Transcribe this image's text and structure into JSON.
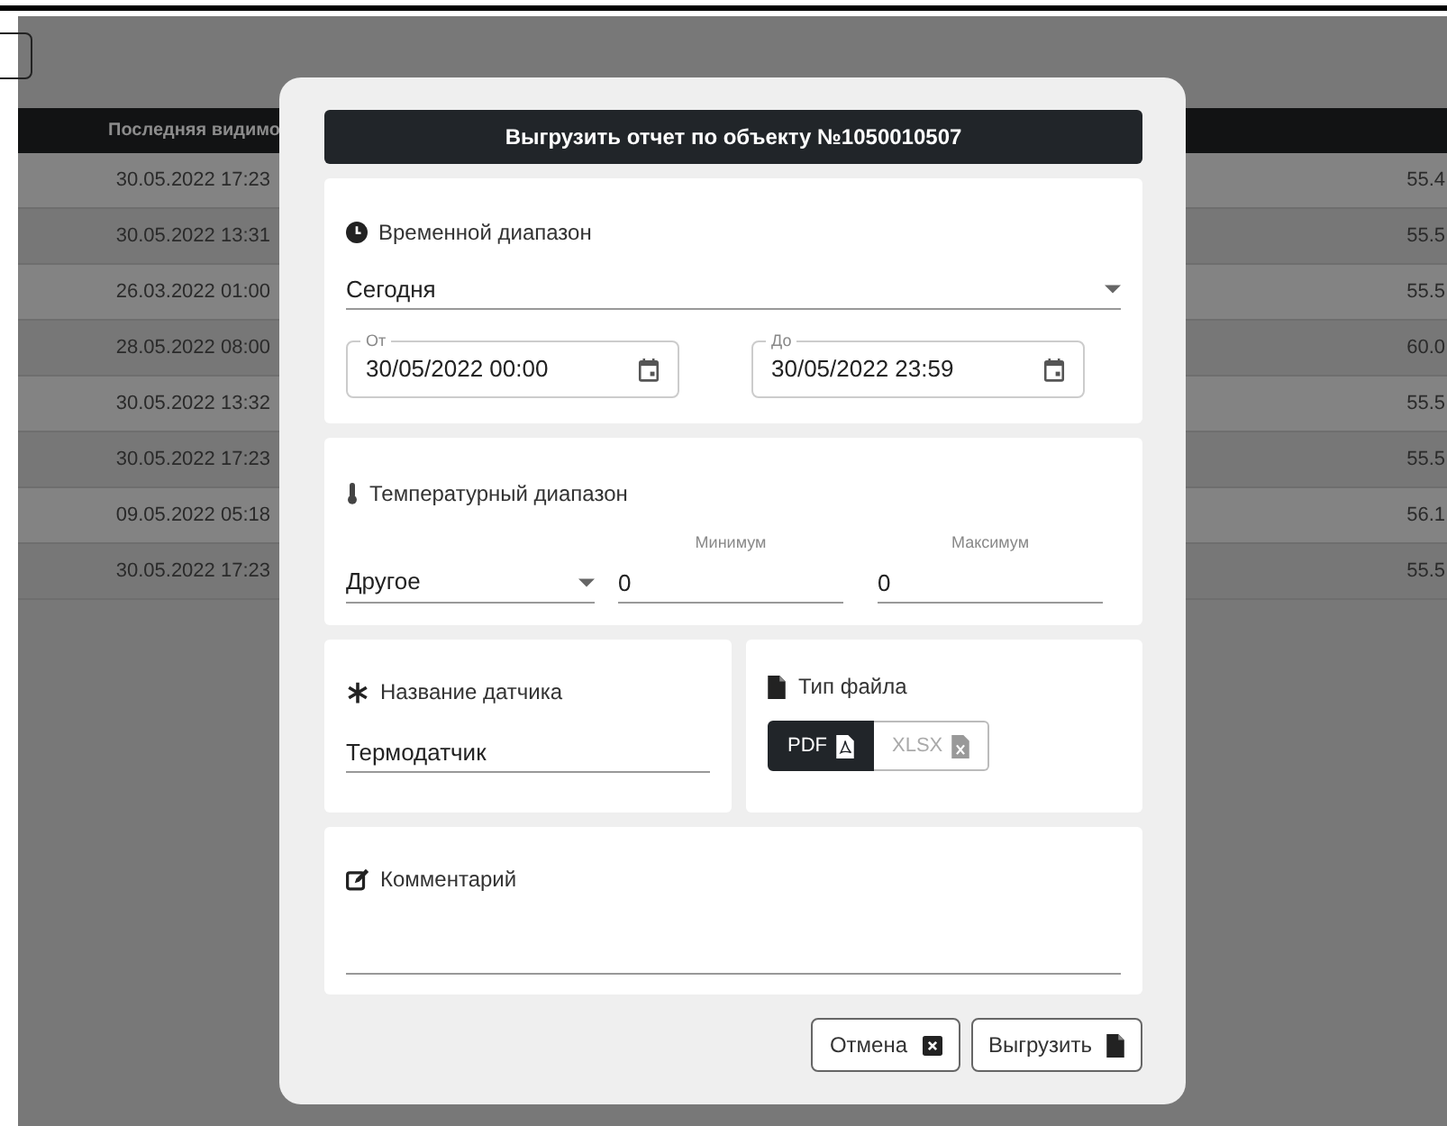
{
  "background_table": {
    "columns": [
      {
        "label": "Последняя видимо"
      }
    ],
    "rows": [
      {
        "last_seen": "30.05.2022 17:23",
        "column_2": "55.4"
      },
      {
        "last_seen": "30.05.2022 13:31",
        "column_2": "55.5"
      },
      {
        "last_seen": "26.03.2022 01:00",
        "column_2": "55.5"
      },
      {
        "last_seen": "28.05.2022 08:00",
        "column_2": "60.0"
      },
      {
        "last_seen": "30.05.2022 13:32",
        "column_2": "55.5"
      },
      {
        "last_seen": "30.05.2022 17:23",
        "column_2": "55.5"
      },
      {
        "last_seen": "09.05.2022 05:18",
        "column_2": "56.1"
      },
      {
        "last_seen": "30.05.2022 17:23",
        "column_2": "55.5"
      }
    ]
  },
  "dialog": {
    "title": "Выгрузить отчет по объекту №1050010507",
    "time_range": {
      "label": "Временной диапазон",
      "preset": "Сегодня",
      "from": {
        "label": "От",
        "value": "30/05/2022 00:00"
      },
      "to": {
        "label": "До",
        "value": "30/05/2022 23:59"
      }
    },
    "temperature_range": {
      "label": "Температурный диапазон",
      "preset": "Другое",
      "min": {
        "label": "Минимум",
        "value": "0"
      },
      "max": {
        "label": "Максимум",
        "value": "0"
      }
    },
    "sensor_name": {
      "label": "Название датчика",
      "value": "Термодатчик"
    },
    "file_type": {
      "label": "Тип файла",
      "options": [
        {
          "label": "PDF",
          "kind": "pdf",
          "selected": true
        },
        {
          "label": "XLSX",
          "kind": "xlsx",
          "selected": false
        }
      ]
    },
    "comment": {
      "label": "Комментарий"
    },
    "buttons": [
      {
        "label": "Отмена",
        "kind": "cancel"
      },
      {
        "label": "Выгрузить",
        "kind": "export"
      }
    ]
  }
}
